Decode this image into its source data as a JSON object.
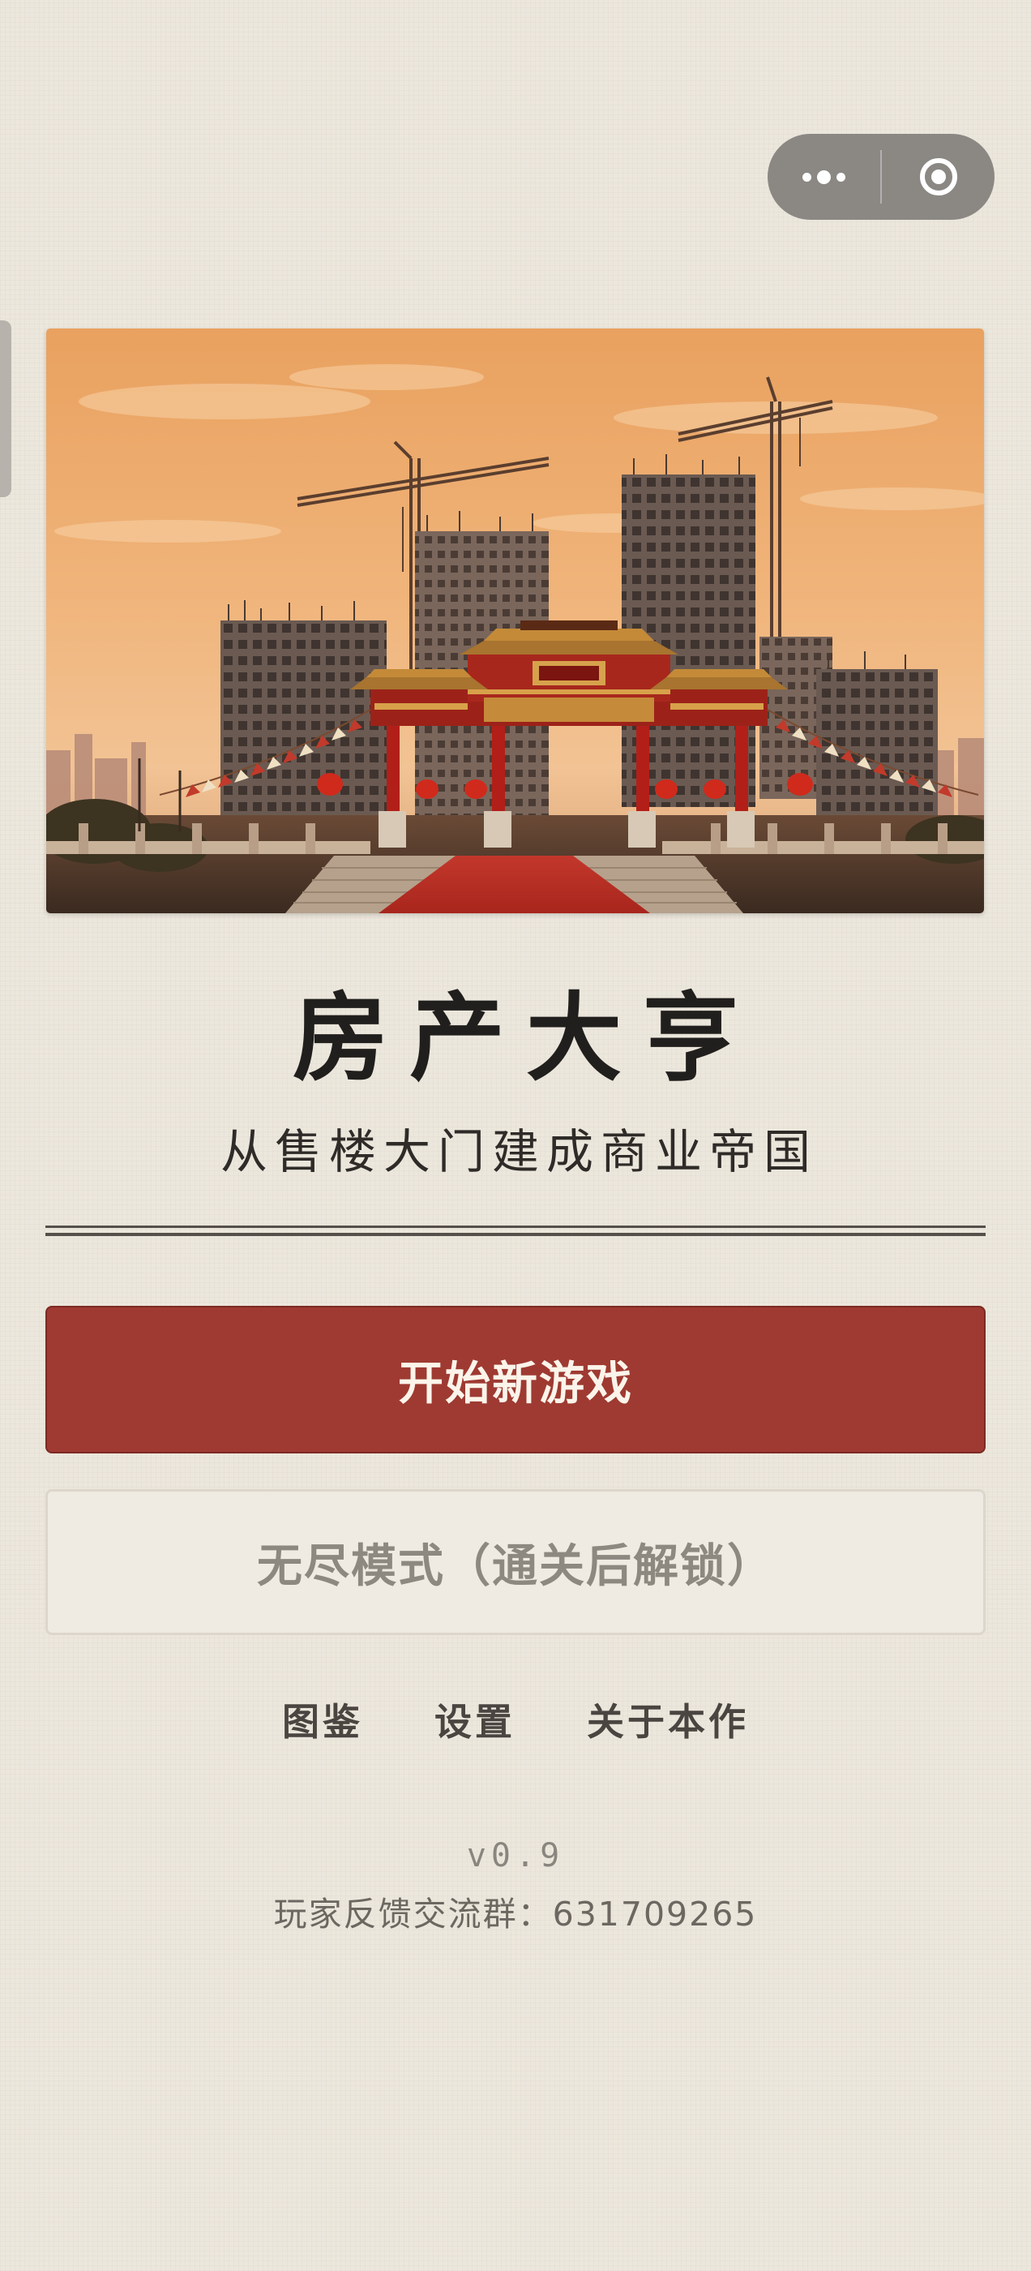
{
  "capsule": {
    "more_icon": "more-dots-icon",
    "close_icon": "target-circle-icon"
  },
  "hero": {
    "description_icon": "memorial-archway-construction-illustration"
  },
  "game": {
    "title": "房产大亨",
    "subtitle": "从售楼大门建成商业帝国"
  },
  "menu": {
    "start_label": "开始新游戏",
    "endless_label": "无尽模式（通关后解锁）",
    "endless_locked": true
  },
  "links": {
    "gallery": "图鉴",
    "settings": "设置",
    "about": "关于本作"
  },
  "footer": {
    "version": "v0.9",
    "feedback": "玩家反馈交流群：631709265"
  },
  "colors": {
    "background": "#ece7dc",
    "primary_button": "#9e3a32",
    "secondary_button": "#efebe2",
    "title_text": "#211f1d"
  }
}
